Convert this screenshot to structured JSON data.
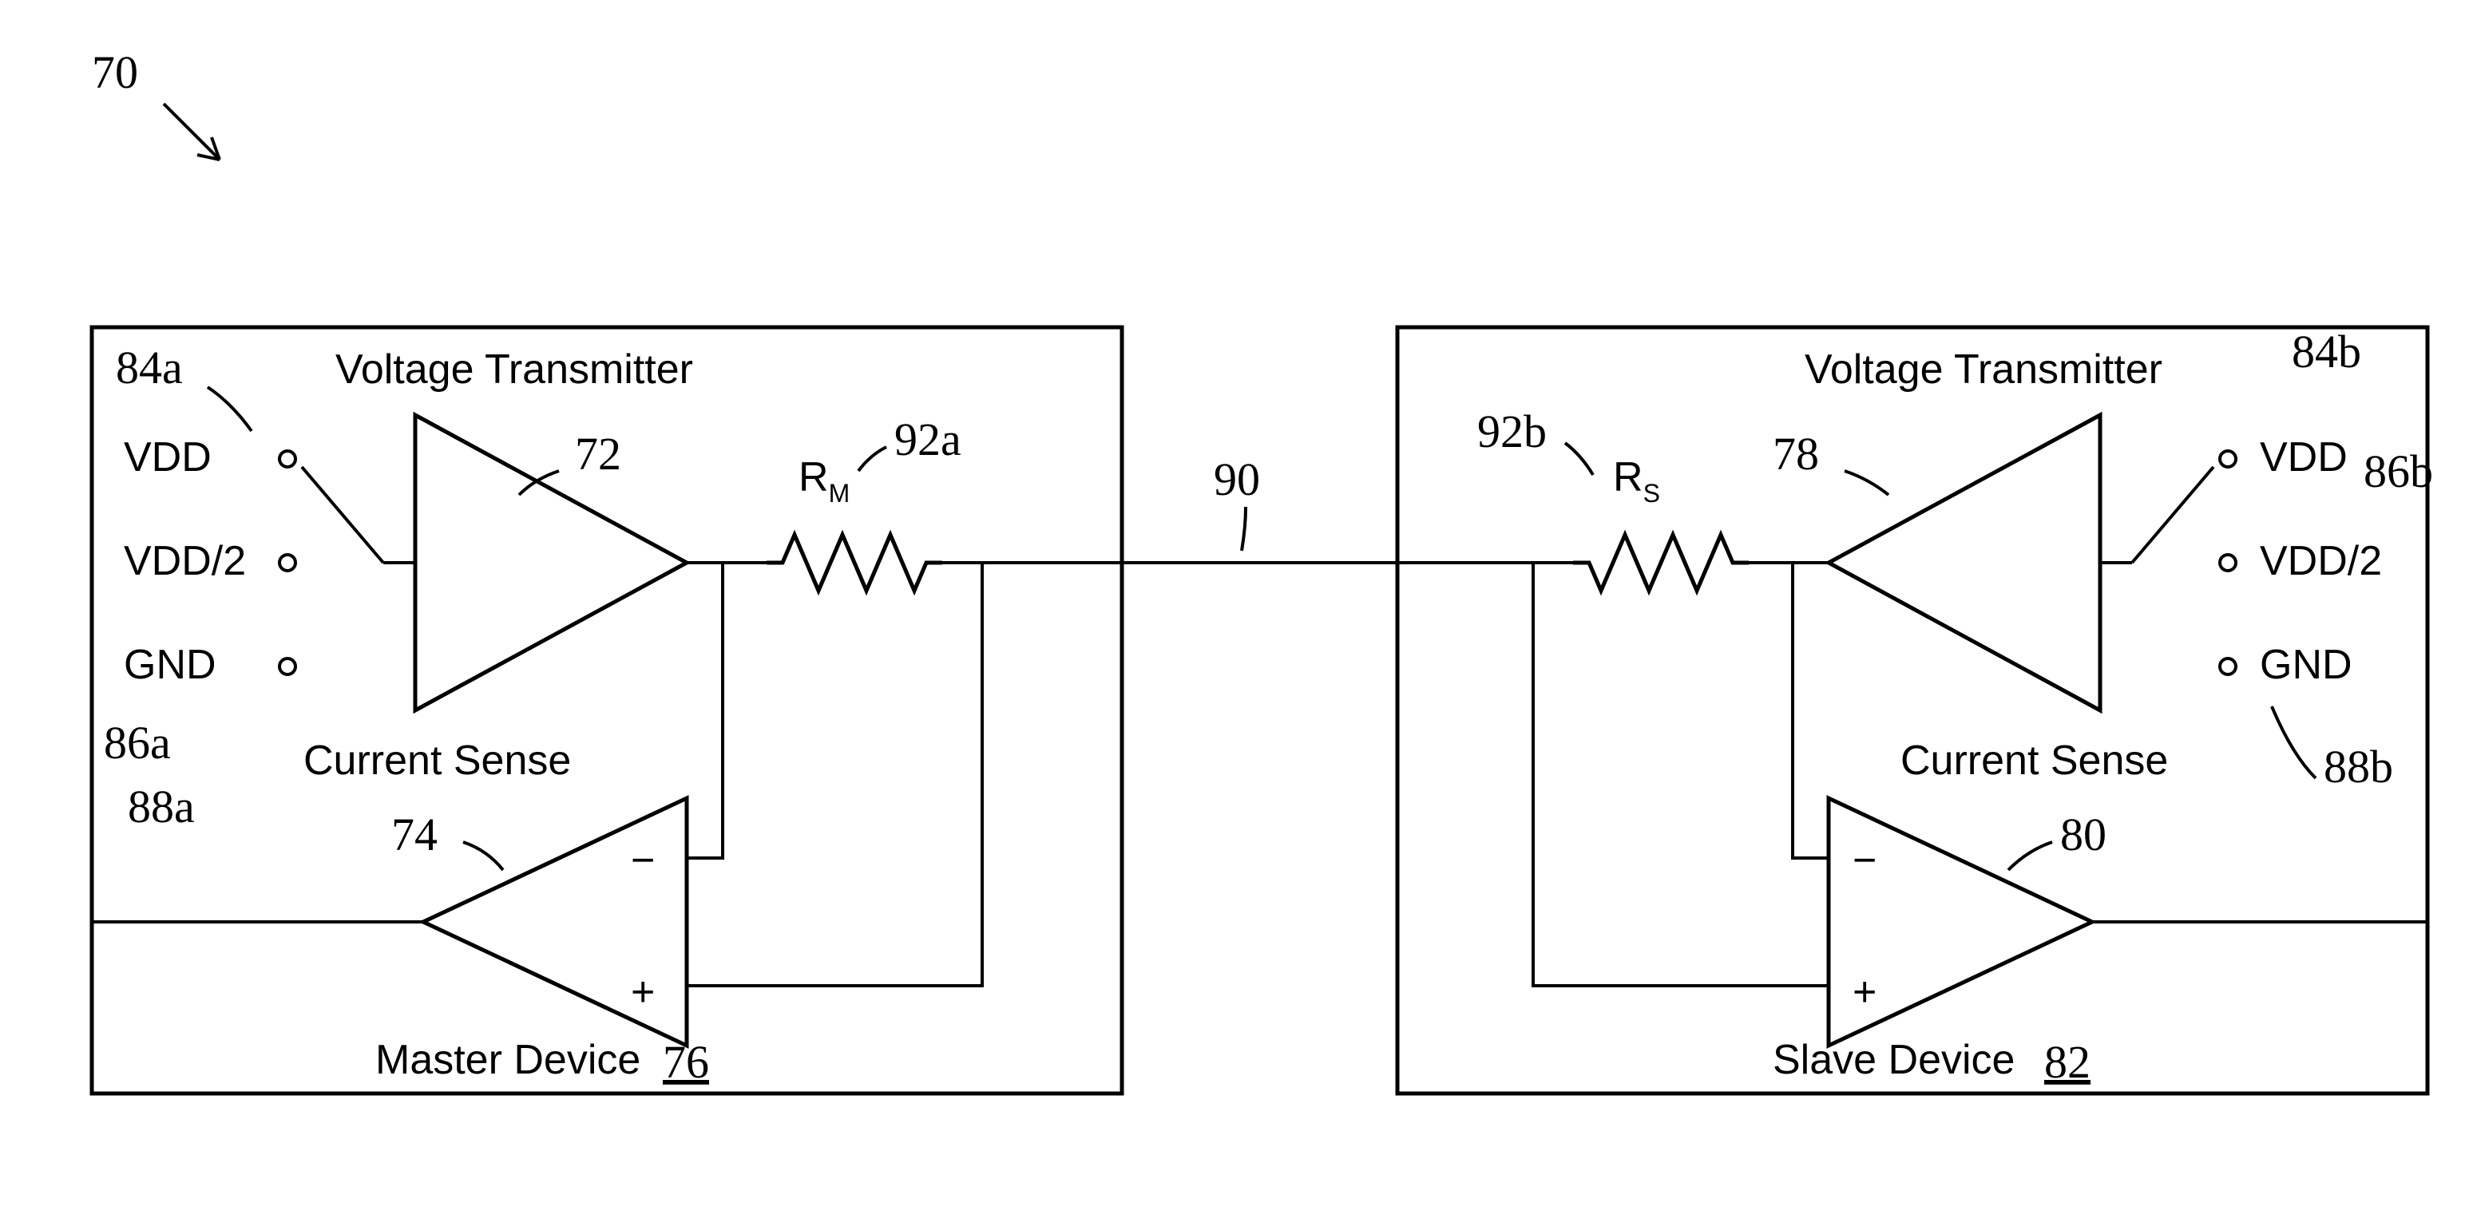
{
  "figure_label": "70",
  "wire_label": "90",
  "master": {
    "title": "Master Device",
    "number": "76",
    "voltage_transmitter_label": "Voltage Transmitter",
    "voltage_transmitter_number": "72",
    "current_sense_label": "Current Sense",
    "current_sense_number": "74",
    "resistor_label": "R",
    "resistor_sub": "M",
    "resistor_number": "92a",
    "levels": {
      "vdd": "VDD",
      "half": "VDD/2",
      "gnd": "GND"
    },
    "level_numbers": {
      "vdd": "84a",
      "half": "86a",
      "gnd": "88a"
    }
  },
  "slave": {
    "title": "Slave Device",
    "number": "82",
    "voltage_transmitter_label": "Voltage Transmitter",
    "voltage_transmitter_number": "78",
    "current_sense_label": "Current Sense",
    "current_sense_number": "80",
    "resistor_label": "R",
    "resistor_sub": "S",
    "resistor_number": "92b",
    "levels": {
      "vdd": "VDD",
      "half": "VDD/2",
      "gnd": "GND"
    },
    "level_numbers": {
      "vdd": "84b",
      "half": "86b",
      "gnd": "88b"
    }
  },
  "sense_plus": "+",
  "sense_minus": "−"
}
